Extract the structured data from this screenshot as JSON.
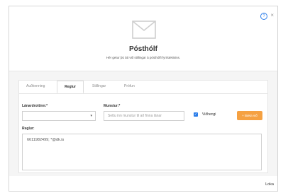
{
  "header": {
    "help_icon": "?",
    "close_icon": "×",
    "title": "Pósthólf",
    "subtitle": "Hér getur þú átt við stillingar á pósthólfi fyrirtækisins."
  },
  "tabs": [
    {
      "label": "Auðkenning",
      "active": false
    },
    {
      "label": "Reglur",
      "active": true
    },
    {
      "label": "Stillingar",
      "active": false
    },
    {
      "label": "Prófun",
      "active": false
    }
  ],
  "form": {
    "lender_label": "Lánardrottinn:*",
    "lender_value": "",
    "pattern_label": "Munstur:*",
    "pattern_placeholder": "Settu inn munstur til að finna lánar",
    "attachment_label": "Viðhengi",
    "attachment_checked": true,
    "add_button": "+ Bæta við",
    "rules_label": "Reglur:",
    "rules_value": "6611982499; *@dk.is"
  },
  "footer": {
    "close_label": "Loka"
  },
  "colors": {
    "accent": "#2b7de9",
    "button": "#f5a142"
  }
}
